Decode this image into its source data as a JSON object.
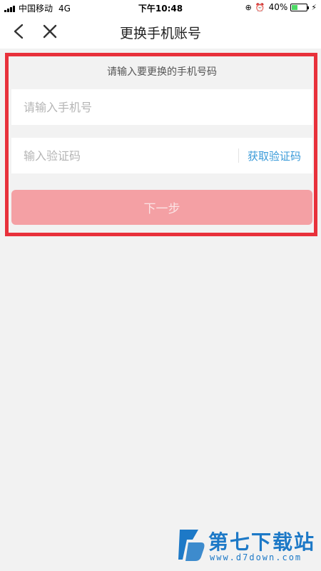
{
  "status_bar": {
    "carrier": "中国移动",
    "network": "4G",
    "time": "下午10:48",
    "battery": "40%",
    "battery_level": 0.4
  },
  "nav": {
    "title": "更换手机账号",
    "back_icon": "chevron-left-icon",
    "close_icon": "close-icon"
  },
  "form": {
    "hint": "请输入要更换的手机号码",
    "phone_placeholder": "请输入手机号",
    "code_placeholder": "输入验证码",
    "get_code_label": "获取验证码",
    "next_label": "下一步"
  },
  "watermark": {
    "title": "第七下载站",
    "url": "www.d7down.com"
  },
  "colors": {
    "accent_link": "#3a9bd9",
    "button_disabled": "#f4a0a4",
    "highlight_border": "#e8313b",
    "watermark": "#1d79c7"
  }
}
